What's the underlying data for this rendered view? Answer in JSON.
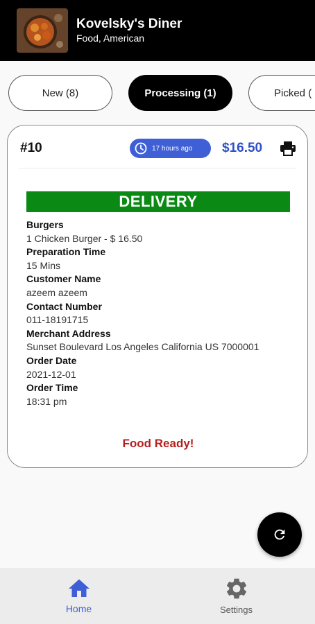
{
  "header": {
    "title": "Kovelsky's Diner",
    "subtitle": "Food, American"
  },
  "tabs": [
    {
      "label": "New (8)"
    },
    {
      "label": "Processing (1)"
    },
    {
      "label": "Picked ("
    }
  ],
  "order": {
    "number": "#10",
    "time_ago": "17 hours ago",
    "price": "$16.50",
    "type": "DELIVERY",
    "fields": {
      "category_label": "Burgers",
      "item": "1 Chicken Burger - $ 16.50",
      "prep_label": "Preparation Time",
      "prep_value": "15 Mins",
      "customer_label": "Customer Name",
      "customer_value": "azeem azeem",
      "contact_label": "Contact Number",
      "contact_value": "011-18191715",
      "address_label": "Merchant Address",
      "address_value": "Sunset Boulevard Los Angeles California US 7000001",
      "date_label": "Order Date",
      "date_value": "2021-12-01",
      "time_label": "Order Time",
      "time_value": "18:31 pm"
    },
    "status": "Food Ready!"
  },
  "nav": {
    "home": "Home",
    "settings": "Settings"
  },
  "colors": {
    "accent": "#3f5fd6",
    "delivery": "#0a8a14",
    "status": "#b61e1e",
    "price": "#2e4fc9"
  },
  "icons": {
    "print": "printer-icon",
    "clock": "clock-icon",
    "refresh": "refresh-icon",
    "home": "home-icon",
    "settings": "gear-icon"
  }
}
